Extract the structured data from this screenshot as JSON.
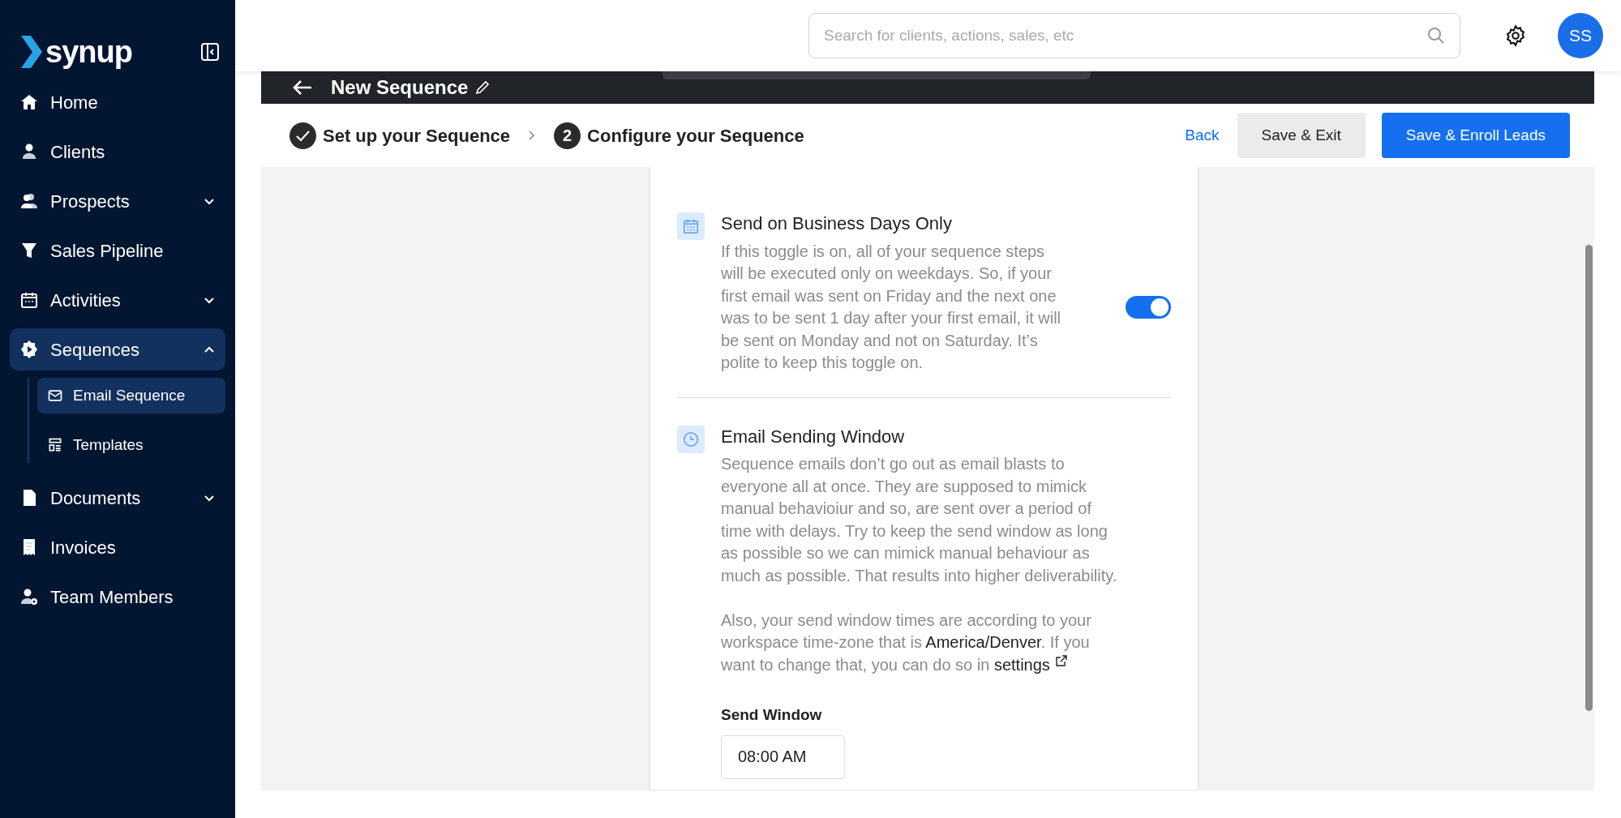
{
  "sidebar": {
    "logo": "synup",
    "items": [
      {
        "label": "Home",
        "selected": false
      },
      {
        "label": "Clients",
        "selected": false
      },
      {
        "label": "Prospects",
        "selected": false,
        "expanded": false
      },
      {
        "label": "Sales Pipeline",
        "selected": false
      },
      {
        "label": "Activities",
        "selected": false,
        "expanded": false
      },
      {
        "label": "Sequences",
        "selected": true,
        "expanded": true,
        "children": [
          {
            "label": "Email Sequence",
            "selected": true
          },
          {
            "label": "Templates",
            "selected": false
          }
        ]
      },
      {
        "label": "Documents",
        "selected": false,
        "expanded": false
      },
      {
        "label": "Invoices",
        "selected": false
      },
      {
        "label": "Team Members",
        "selected": false
      }
    ]
  },
  "header": {
    "search": {
      "placeholder": "Search for clients, actions, sales, etc"
    },
    "avatar": "SS"
  },
  "editor": {
    "title": "New Sequence"
  },
  "steps": [
    {
      "label": "Set up your Sequence",
      "done": true
    },
    {
      "label": "Configure your Sequence",
      "done": false,
      "number": "2"
    }
  ],
  "actions": [
    {
      "label": "Back",
      "kind": "link"
    },
    {
      "label": "Save & Exit",
      "kind": "secondary"
    },
    {
      "label": "Save & Enroll Leads",
      "kind": "primary"
    }
  ],
  "sections": [
    {
      "kind": "toggle",
      "title": "Send on Business Days Only",
      "paragraphs": [
        "If this toggle is on, all of your sequence steps will be executed only on weekdays. So, if your first email was sent on Friday and the next one was to be sent 1 day after your first email, it will be sent on Monday and not on Saturday. It’s polite to keep this toggle on."
      ],
      "on": true
    },
    {
      "kind": "window",
      "title": "Email Sending Window",
      "paragraphs": [
        "Sequence emails don’t go out as email blasts to everyone all at once. They are supposed to mimick manual behavioiur and so, are sent over a period of time with delays. Try to keep the send window as long as possible so we can mimick manual behaviour as much as possible. That results into higher deliverability.",
        "Also, your send window times are according to your workspace time-zone that is **America/Denver**. If you want to change that, you can do so in"
      ],
      "link": "settings",
      "field_label": "Send Window",
      "field_value": "08:00 AM"
    }
  ]
}
